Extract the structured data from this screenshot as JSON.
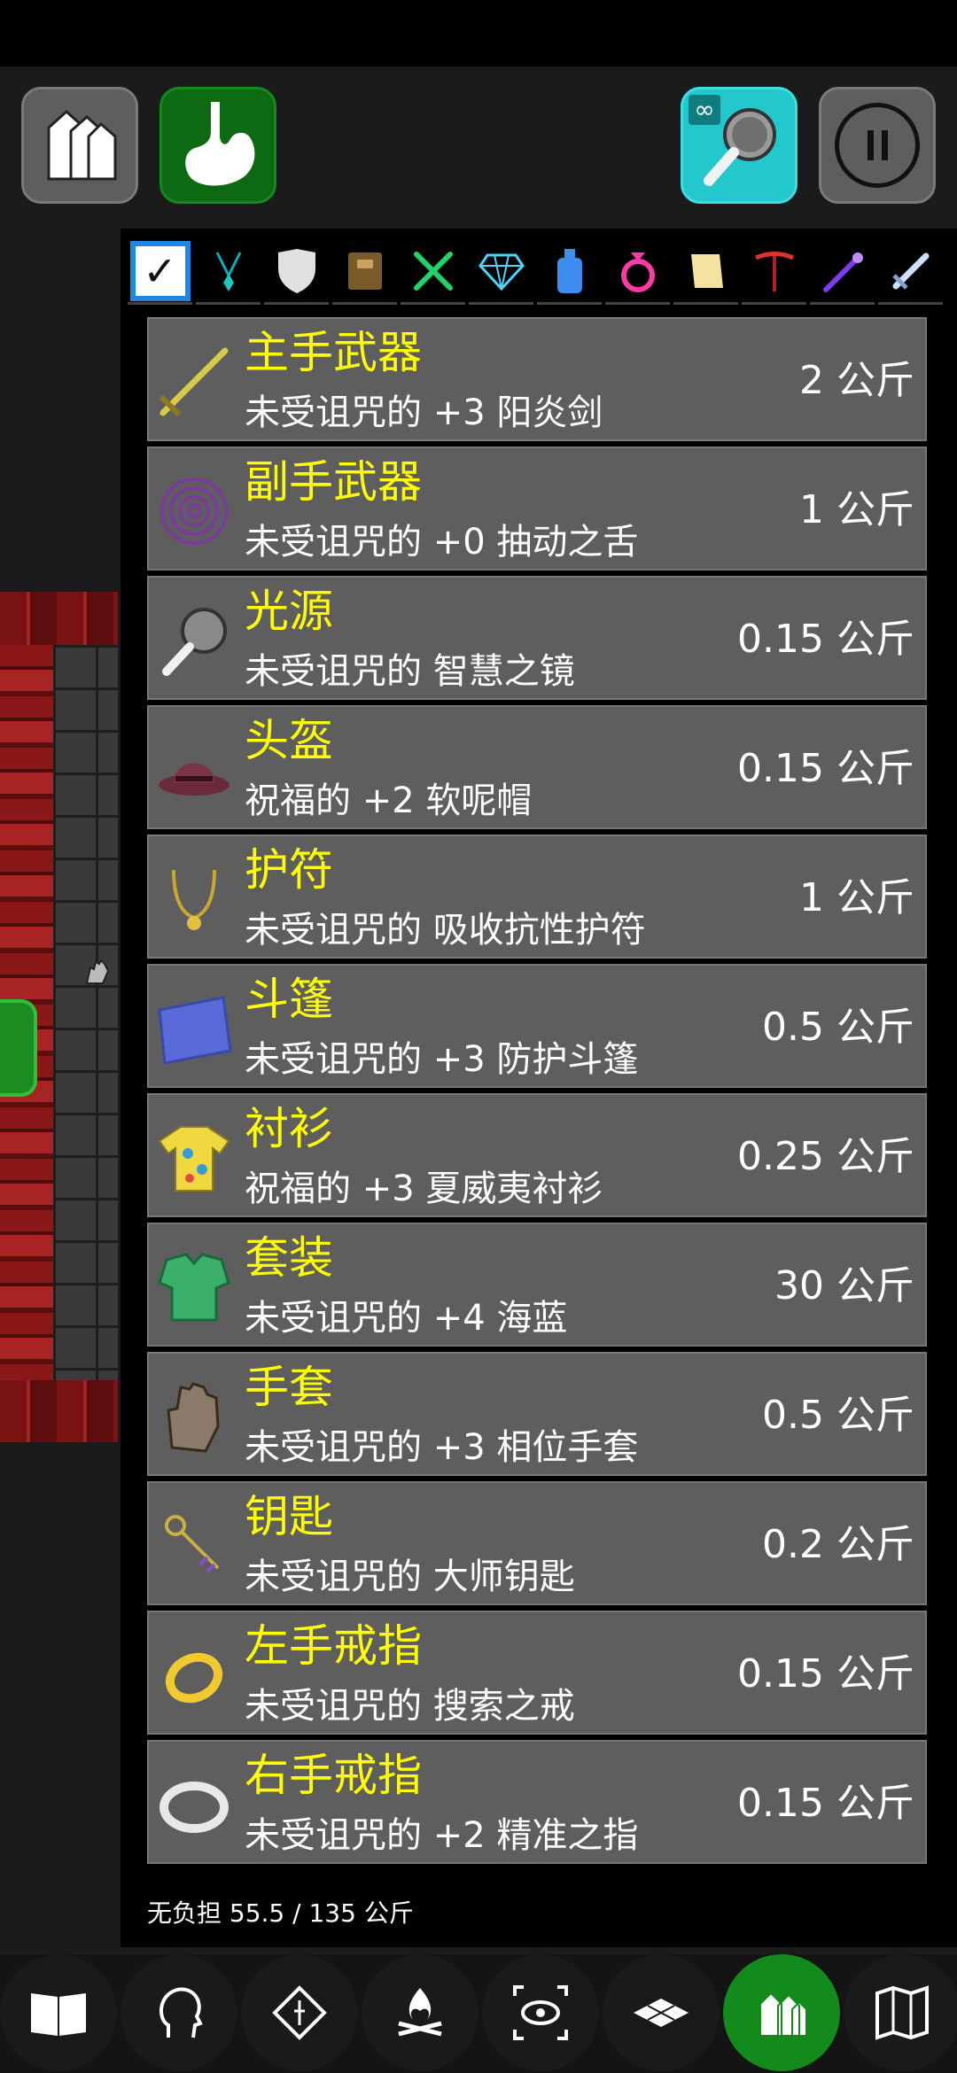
{
  "top_bar": {
    "inventory_icon": "inventory-bags-icon",
    "hunger_icon": "stomach-icon",
    "light_badge": "∞",
    "light_icon": "mirror-icon",
    "pause_icon": "pause-icon"
  },
  "filters": [
    {
      "icon": "checkbox-all-icon",
      "active": true
    },
    {
      "icon": "amulet-icon"
    },
    {
      "icon": "shield-icon"
    },
    {
      "icon": "spellbook-icon"
    },
    {
      "icon": "food-icon"
    },
    {
      "icon": "gem-icon"
    },
    {
      "icon": "potion-icon"
    },
    {
      "icon": "ring-icon"
    },
    {
      "icon": "scroll-icon"
    },
    {
      "icon": "tool-icon"
    },
    {
      "icon": "wand-icon"
    },
    {
      "icon": "weapon-icon"
    }
  ],
  "items": [
    {
      "slot": "主手武器",
      "name": "未受诅咒的 +3 阳炎剑",
      "weight": "2 公斤",
      "icon": "sword-icon"
    },
    {
      "slot": "副手武器",
      "name": "未受诅咒的 +0 抽动之舌",
      "weight": "1 公斤",
      "icon": "whip-icon"
    },
    {
      "slot": "光源",
      "name": "未受诅咒的 智慧之镜",
      "weight": "0.15 公斤",
      "icon": "mirror-icon"
    },
    {
      "slot": "头盔",
      "name": "祝福的 +2 软呢帽",
      "weight": "0.15 公斤",
      "icon": "fedora-icon"
    },
    {
      "slot": "护符",
      "name": "未受诅咒的 吸收抗性护符",
      "weight": "1 公斤",
      "icon": "amulet-icon"
    },
    {
      "slot": "斗篷",
      "name": "未受诅咒的 +3 防护斗篷",
      "weight": "0.5 公斤",
      "icon": "cloak-icon"
    },
    {
      "slot": "衬衫",
      "name": "祝福的 +3 夏威夷衬衫",
      "weight": "0.25 公斤",
      "icon": "shirt-icon"
    },
    {
      "slot": "套装",
      "name": "未受诅咒的 +4 海蓝",
      "weight": "30 公斤",
      "icon": "armor-icon"
    },
    {
      "slot": "手套",
      "name": "未受诅咒的 +3 相位手套",
      "weight": "0.5 公斤",
      "icon": "gloves-icon"
    },
    {
      "slot": "钥匙",
      "name": "未受诅咒的 大师钥匙",
      "weight": "0.2 公斤",
      "icon": "key-icon"
    },
    {
      "slot": "左手戒指",
      "name": "未受诅咒的 搜索之戒",
      "weight": "0.15 公斤",
      "icon": "gold-ring-icon"
    },
    {
      "slot": "右手戒指",
      "name": "未受诅咒的 +2 精准之指",
      "weight": "0.15 公斤",
      "icon": "silver-ring-icon"
    }
  ],
  "weight_summary": "无负担 55.5 / 135 公斤",
  "bottom_bar": [
    {
      "icon": "book-icon"
    },
    {
      "icon": "head-icon"
    },
    {
      "icon": "pray-icon"
    },
    {
      "icon": "campfire-icon"
    },
    {
      "icon": "look-icon"
    },
    {
      "icon": "floor-icon"
    },
    {
      "icon": "inventory-bags-icon",
      "active": true
    },
    {
      "icon": "map-icon"
    }
  ]
}
